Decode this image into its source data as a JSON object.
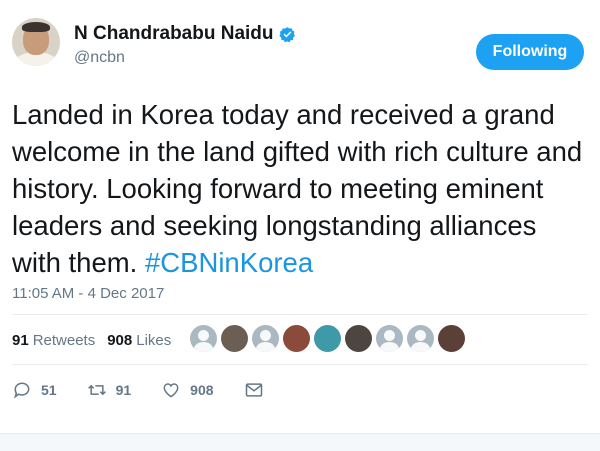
{
  "user": {
    "name": "N Chandrababu Naidu",
    "handle": "@ncbn",
    "verified_icon": "verified-badge-icon",
    "follow_label": "Following",
    "accent": "#1da1f2"
  },
  "tweet": {
    "text": "Landed in Korea today and received a grand welcome in the land gifted with rich culture and history. Looking forward to meeting eminent leaders and seeking longstanding alliances with them. ",
    "hashtag": "#CBNinKorea",
    "timestamp": "11:05 AM - 4 Dec 2017"
  },
  "stats": {
    "retweets_count": "91",
    "retweets_label": "Retweets",
    "likes_count": "908",
    "likes_label": "Likes"
  },
  "engagers": [
    "default-avatar",
    "photo",
    "default-avatar",
    "photo",
    "photo",
    "photo",
    "default-avatar",
    "default-avatar",
    "photo"
  ],
  "actions": {
    "reply_count": "51",
    "retweet_count": "91",
    "like_count": "908",
    "icons": [
      "reply-icon",
      "retweet-icon",
      "like-icon",
      "message-icon"
    ]
  }
}
